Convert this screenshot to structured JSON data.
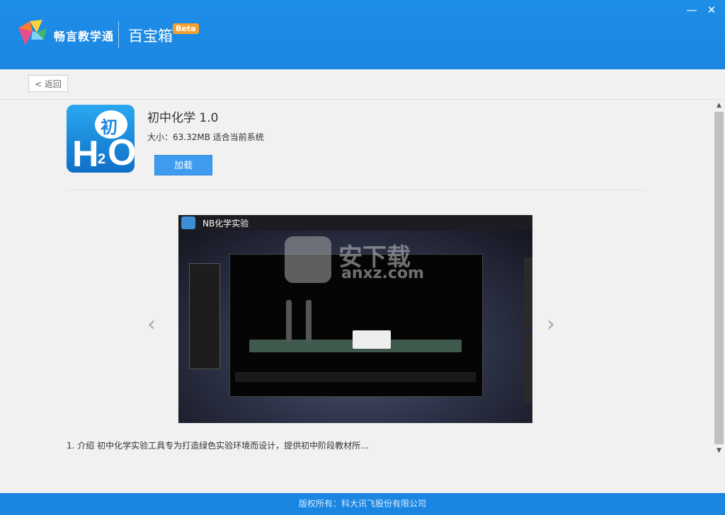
{
  "header": {
    "brand": "畅言教学通",
    "app_name": "百宝箱",
    "beta": "Beta",
    "minimize_symbol": "—",
    "close_symbol": "✕"
  },
  "toolbar": {
    "back_label": "< 返回"
  },
  "app": {
    "icon_text": {
      "chu": "初",
      "h": "H",
      "sub": "2",
      "o": "O"
    },
    "title": "初中化学 1.0",
    "meta": "大小：63.32MB 适合当前系统",
    "load_label": "加载"
  },
  "screenshot": {
    "window_title": "NB化学实验",
    "watermark_text": "安下载",
    "watermark_sub": "anxz.com"
  },
  "carousel": {
    "prev_symbol": "‹",
    "next_symbol": "›"
  },
  "description": "1. 介绍 初中化学实验工具专为打造绿色实验环境而设计，提供初中阶段教材所...",
  "footer": {
    "text": "版权所有：科大讯飞股份有限公司"
  },
  "colors": {
    "brand_blue": "#1a86e2",
    "button_blue": "#3d9cf0",
    "beta_orange": "#f6a12a"
  }
}
